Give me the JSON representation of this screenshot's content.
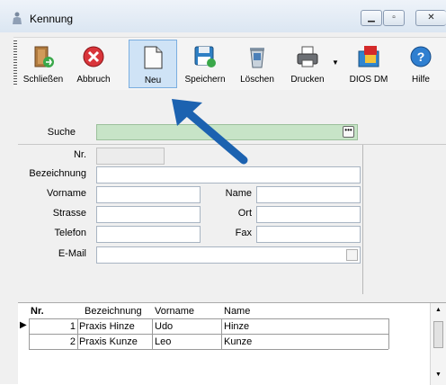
{
  "window": {
    "title": "Kennung",
    "controls": [
      "minimize",
      "maximize",
      "close"
    ]
  },
  "toolbar": {
    "buttons": [
      {
        "label": "Schließen",
        "icon": "door-exit-icon"
      },
      {
        "label": "Abbruch",
        "icon": "cancel-x-icon"
      },
      {
        "label": "Neu",
        "icon": "new-document-icon",
        "state": "highlighted"
      },
      {
        "label": "Speichern",
        "icon": "floppy-disk-icon"
      },
      {
        "label": "Löschen",
        "icon": "trash-bin-icon"
      },
      {
        "label": "Drucken",
        "icon": "printer-icon"
      },
      {
        "label": "DIOS DM",
        "icon": "dios-dm-pdf-icon"
      },
      {
        "label": "Hilfe",
        "icon": "help-icon"
      }
    ]
  },
  "search": {
    "label": "Suche",
    "value": ""
  },
  "form": {
    "nr_label": "Nr.",
    "bezeichnung_label": "Bezeichnung",
    "vorname_label": "Vorname",
    "name_label": "Name",
    "strasse_label": "Strasse",
    "ort_label": "Ort",
    "telefon_label": "Telefon",
    "fax_label": "Fax",
    "email_label": "E-Mail",
    "nr_value": "",
    "bezeichnung_value": "",
    "vorname_value": "",
    "name_value": "",
    "strasse_value": "",
    "ort_value": "",
    "telefon_value": "",
    "fax_value": "",
    "email_value": ""
  },
  "table": {
    "columns": [
      "Nr.",
      "Bezeichnung",
      "Vorname",
      "Name"
    ],
    "rows": [
      {
        "nr": "1",
        "bezeichnung": "Praxis Hinze",
        "vorname": "Udo",
        "name": "Hinze"
      },
      {
        "nr": "2",
        "bezeichnung": "Praxis Kunze",
        "vorname": "Leo",
        "name": "Kunze"
      }
    ]
  },
  "colors": {
    "search_field": "#c7e4c7",
    "highlight": "#cfe3f6",
    "arrow": "#1c62b0"
  }
}
